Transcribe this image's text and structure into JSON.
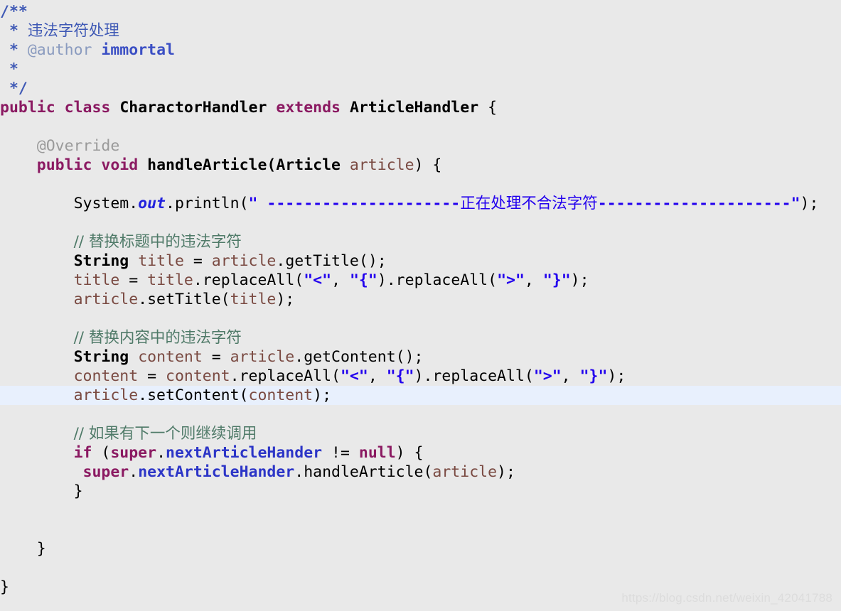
{
  "editor": {
    "background_color": "#e9e9e9",
    "highlight_color": "#e8f0fd",
    "language": "java",
    "highlighted_line_number": 19,
    "indent_unit": "    "
  },
  "colors": {
    "keyword": "#8b1a62",
    "string": "#2200ee",
    "comment": "#4f7a68",
    "javadoc": "#3f59b5",
    "javadoc_tag": "#8a9bbf",
    "field": "#2c35c7",
    "local_variable": "#7a4a42",
    "annotation": "#9a9a9a",
    "static_field": "#2222dd",
    "plain": "#000000"
  },
  "code": {
    "line01": {
      "doc_open": "/**"
    },
    "line02": {
      "star": " * ",
      "text": "违法字符处理"
    },
    "line03": {
      "star": " * ",
      "tag": "@author",
      "space": " ",
      "value": "immortal"
    },
    "line04": {
      "star": " *"
    },
    "line05": {
      "doc_close": " */"
    },
    "line06": {
      "kw_public": "public",
      "sp1": " ",
      "kw_class": "class",
      "sp2": " ",
      "class_name": "CharactorHandler",
      "sp3": " ",
      "kw_extends": "extends",
      "sp4": " ",
      "super_name": "ArticleHandler",
      "brace": " {"
    },
    "line07": {
      "blank": ""
    },
    "line08": {
      "indent": "    ",
      "annotation": "@Override"
    },
    "line09": {
      "indent": "    ",
      "kw_public": "public",
      "sp1": " ",
      "kw_void": "void",
      "sp2": " ",
      "method": "handleArticle(",
      "param_type": "Article",
      "sp3": " ",
      "param_name": "article",
      "tail": ") {"
    },
    "line10": {
      "blank": ""
    },
    "line11": {
      "indent": "        ",
      "receiver": "System.",
      "static_field": "out",
      "call": ".println(",
      "quote_open": "\"",
      "str_prefix": " ---------------------",
      "str_cjk": "正在处理不合法字符",
      "str_suffix": "---------------------",
      "quote_close": "\"",
      "tail": ");"
    },
    "line12": {
      "blank": ""
    },
    "line13": {
      "indent": "        ",
      "comment": "// 替换标题中的违法字符"
    },
    "line14": {
      "indent": "        ",
      "type": "String",
      "sp1": " ",
      "var": "title",
      "op": " = ",
      "obj": "article",
      "call": ".getTitle();"
    },
    "line15": {
      "indent": "        ",
      "var": "title",
      "op": " = ",
      "obj": "title",
      "call1": ".replaceAll(",
      "arg1": "\"<\"",
      "comma1": ", ",
      "arg2": "\"{\"",
      "mid": ").replaceAll(",
      "arg3": "\">\"",
      "comma2": ", ",
      "arg4": "\"}\"",
      "tail": ");"
    },
    "line16": {
      "indent": "        ",
      "obj": "article",
      "call": ".setTitle(",
      "arg": "title",
      "tail": ");"
    },
    "line17": {
      "blank": ""
    },
    "line18": {
      "indent": "        ",
      "comment": "// 替换内容中的违法字符"
    },
    "line19": {
      "indent": "        ",
      "type": "String",
      "sp1": " ",
      "var": "content",
      "op": " = ",
      "obj": "article",
      "call": ".getContent();"
    },
    "line20": {
      "indent": "        ",
      "var": "content",
      "op": " = ",
      "obj": "content",
      "call1": ".replaceAll(",
      "arg1": "\"<\"",
      "comma1": ", ",
      "arg2": "\"{\"",
      "mid": ").replaceAll(",
      "arg3": "\">\"",
      "comma2": ", ",
      "arg4": "\"}\"",
      "tail": ");"
    },
    "line21": {
      "indent": "        ",
      "obj": "article",
      "call": ".setContent(",
      "arg": "content",
      "tail": ");"
    },
    "line22": {
      "blank": ""
    },
    "line23": {
      "indent": "        ",
      "comment": "// 如果有下一个则继续调用"
    },
    "line24": {
      "indent": "        ",
      "kw_if": "if",
      "sp1": " (",
      "kw_super": "super",
      "dot": ".",
      "field": "nextArticleHander",
      "op": " != ",
      "kw_null": "null",
      "tail": ") {"
    },
    "line25": {
      "indent": "         ",
      "kw_super": "super",
      "dot1": ".",
      "field": "nextArticleHander",
      "call": ".handleArticle(",
      "arg": "article",
      "tail": ");"
    },
    "line26": {
      "indent": "        ",
      "brace": "}"
    },
    "line27": {
      "blank": ""
    },
    "line28": {
      "blank": ""
    },
    "line29": {
      "indent": "    ",
      "brace": "}"
    },
    "line30": {
      "blank": ""
    },
    "line31": {
      "brace": "}"
    }
  },
  "watermark": {
    "text": "https://blog.csdn.net/weixin_42041788"
  }
}
